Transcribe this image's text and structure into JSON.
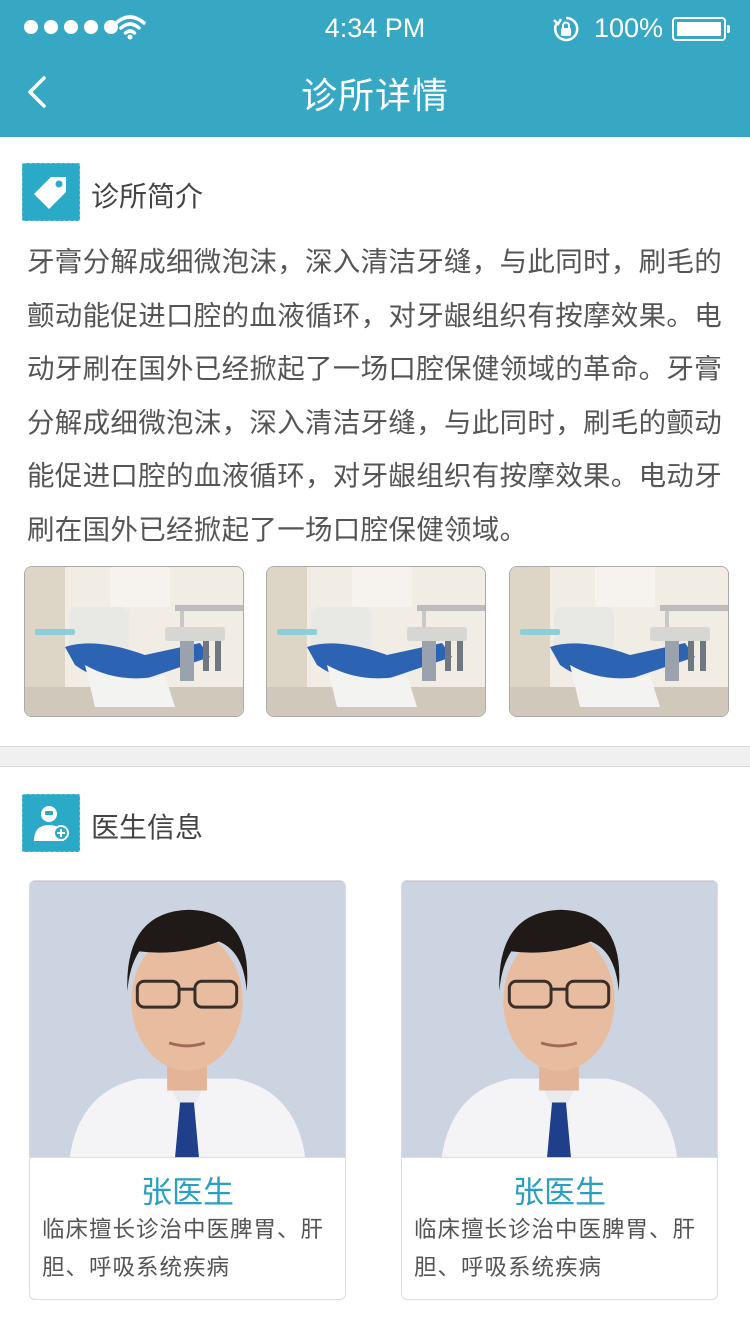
{
  "status_bar": {
    "time": "4:34 PM",
    "battery": "100%"
  },
  "nav": {
    "title": "诊所详情",
    "back_icon": "chevron-left-icon"
  },
  "intro": {
    "title": "诊所简介",
    "icon": "tag-icon",
    "text": "牙膏分解成细微泡沫，深入清洁牙缝，与此同时，刷毛的颤动能促进口腔的血液循环，对牙龈组织有按摩效果。电动牙刷在国外已经掀起了一场口腔保健领域的革命。牙膏分解成细微泡沫，深入清洁牙缝，与此同时，刷毛的颤动能促进口腔的血液循环，对牙龈组织有按摩效果。电动牙刷在国外已经掀起了一场口腔保健领域。",
    "photos": [
      "dental-chair-photo",
      "dental-chair-photo",
      "dental-chair-photo"
    ]
  },
  "doctors": {
    "title": "医生信息",
    "icon": "doctor-icon",
    "items": [
      {
        "name": "张医生",
        "desc": "临床擅长诊治中医脾胃、肝胆、呼吸系统疾病"
      },
      {
        "name": "张医生",
        "desc": "临床擅长诊治中医脾胃、肝胆、呼吸系统疾病"
      }
    ]
  },
  "colors": {
    "primary": "#36a8c3",
    "icon_bg": "#2aaac7",
    "doctor_name": "#2a9fbf"
  }
}
